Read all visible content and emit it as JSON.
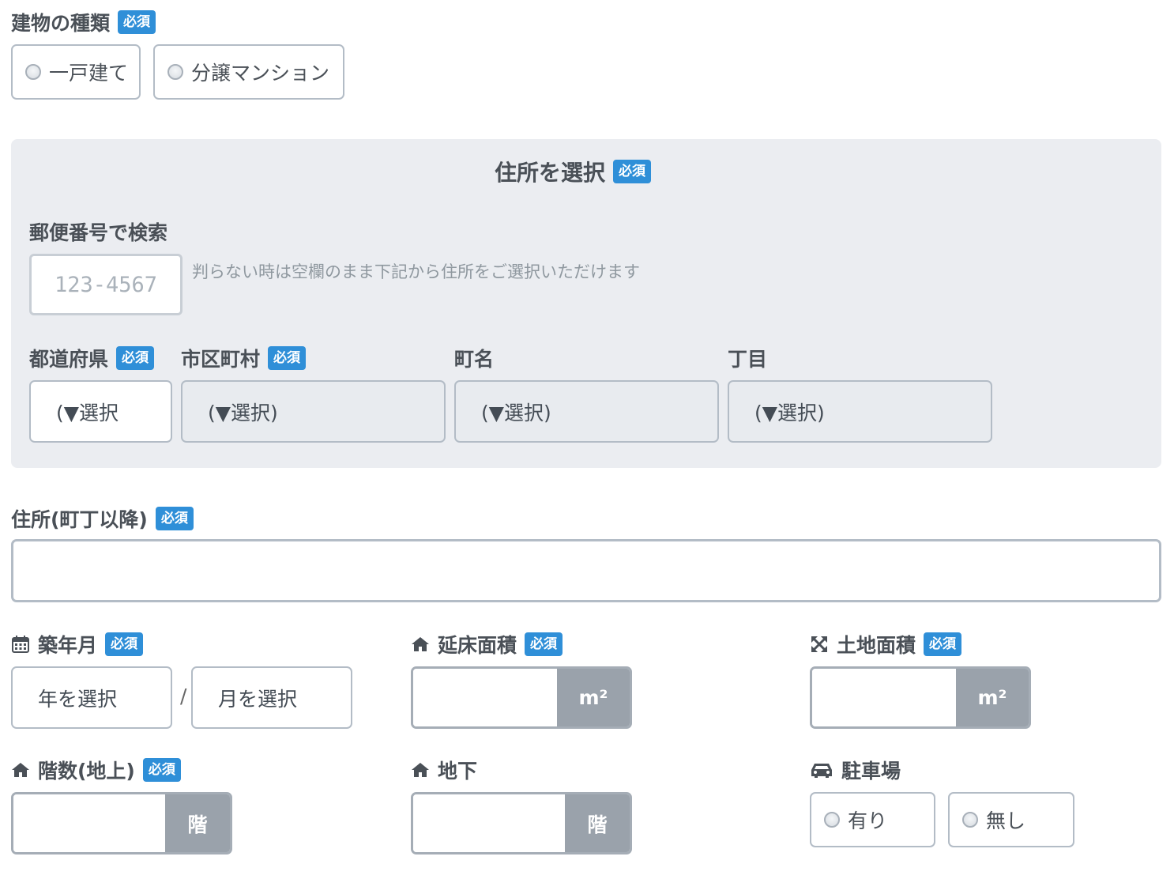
{
  "building_type": {
    "label": "建物の種類",
    "required": "必須",
    "options": [
      "一戸建て",
      "分譲マンション"
    ]
  },
  "address_select": {
    "title": "住所を選択",
    "required": "必須",
    "postal": {
      "label": "郵便番号で検索",
      "placeholder": "123-4567",
      "hint": "判らない時は空欄のまま下記から住所をご選択いただけます"
    },
    "prefecture": {
      "label": "都道府県",
      "required": "必須",
      "value": "(▼選択"
    },
    "city": {
      "label": "市区町村",
      "required": "必須",
      "value": "(▼選択)"
    },
    "town": {
      "label": "町名",
      "value": "(▼選択)"
    },
    "chome": {
      "label": "丁目",
      "value": "(▼選択)"
    }
  },
  "address_detail": {
    "label": "住所(町丁以降)",
    "required": "必須",
    "value": ""
  },
  "built_date": {
    "label": "築年月",
    "required": "必須",
    "year": "年を選択",
    "separator": "/",
    "month": "月を選択"
  },
  "floor_area": {
    "label": "延床面積",
    "required": "必須",
    "unit": "m²"
  },
  "land_area": {
    "label": "土地面積",
    "required": "必須",
    "unit": "m²"
  },
  "floors_above": {
    "label": "階数(地上)",
    "required": "必須",
    "unit": "階"
  },
  "floors_below": {
    "label": "地下",
    "unit": "階"
  },
  "parking": {
    "label": "駐車場",
    "options": [
      "有り",
      "無し"
    ]
  },
  "icons": {
    "calendar": "calendar-icon",
    "home": "home-icon",
    "expand": "expand-arrows-icon",
    "car": "car-icon"
  },
  "colors": {
    "badge": "#2f8fd8",
    "panel": "#ebedf1",
    "unit": "#9aa2ab"
  }
}
